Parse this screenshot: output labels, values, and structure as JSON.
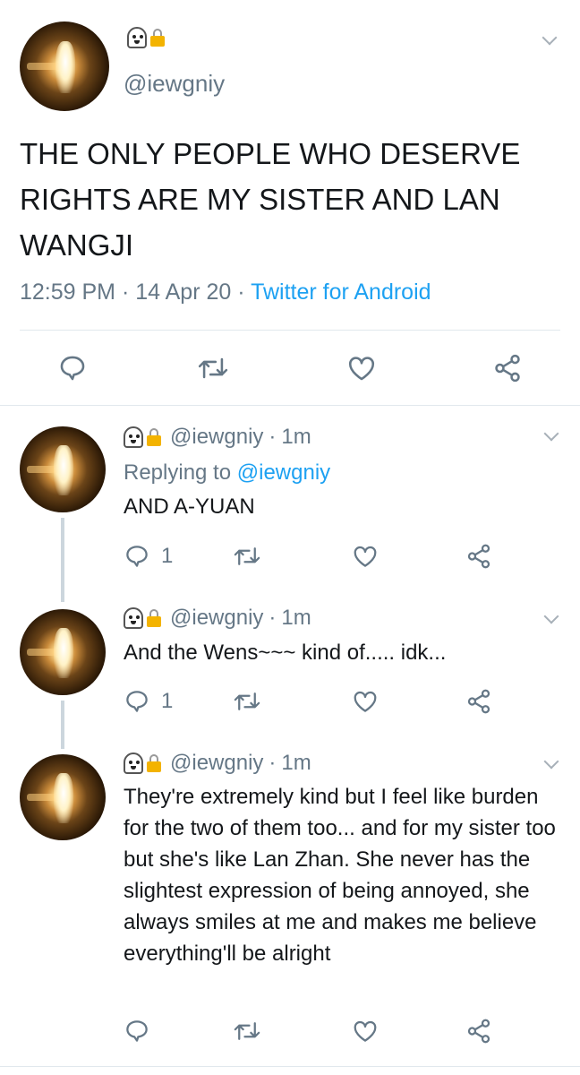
{
  "main_tweet": {
    "handle": "@iewgniy",
    "text": "THE ONLY PEOPLE WHO DESERVE RIGHTS ARE MY SISTER AND LAN WANGJI",
    "time": "12:59 PM",
    "date": "14 Apr 20",
    "separator": "·",
    "source": "Twitter for Android"
  },
  "replies": [
    {
      "handle": "@iewgniy",
      "time": "1m",
      "replying_prefix": "Replying to",
      "replying_handle": "@iewgniy",
      "text": "AND A-YUAN",
      "reply_count": "1"
    },
    {
      "handle": "@iewgniy",
      "time": "1m",
      "text": "And the Wens~~~ kind of..... idk...",
      "reply_count": "1"
    },
    {
      "handle": "@iewgniy",
      "time": "1m",
      "text": "They're extremely kind but I feel like burden for the two of them too... and for my sister too but she's like Lan Zhan. She never has the slightest expression of being annoyed, she always smiles at me and makes me believe everything'll be alright",
      "reply_count": ""
    }
  ],
  "icons": [
    "ghost-emoji-icon",
    "lock-emoji-icon",
    "chevron-down-icon",
    "reply-icon",
    "retweet-icon",
    "like-icon",
    "share-icon"
  ],
  "colors": {
    "link": "#1da1f2",
    "muted": "#657786",
    "divider": "#e1e8ed",
    "thread_line": "#ccd6dd"
  }
}
